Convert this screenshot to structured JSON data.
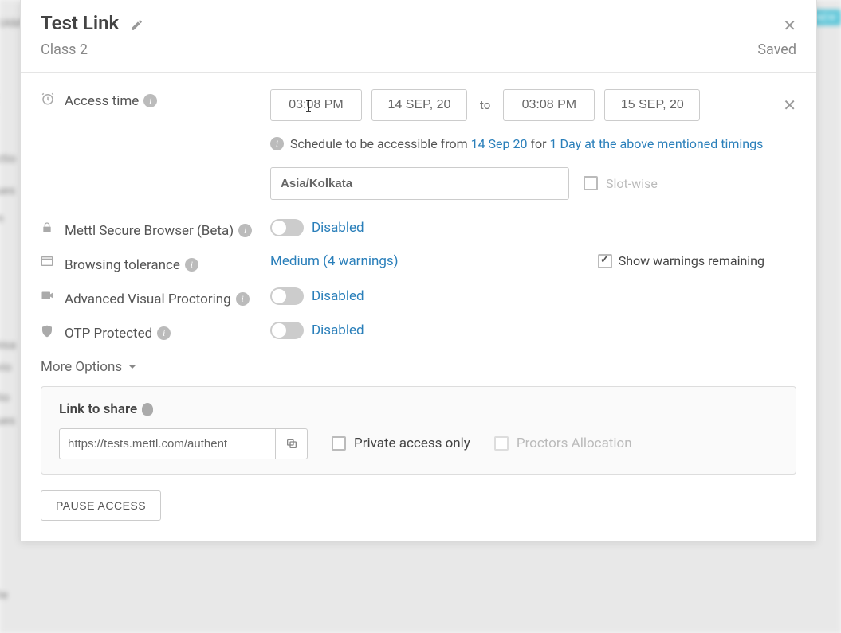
{
  "header": {
    "title": "Test Link",
    "subtitle": "Class 2",
    "saved": "Saved"
  },
  "access_time": {
    "label": "Access time",
    "from_time": "03:08 PM",
    "from_date": "14 SEP, 20",
    "to": "to",
    "to_time": "03:08 PM",
    "to_date": "15 SEP, 20",
    "schedule_prefix": "Schedule to be accessible from ",
    "schedule_date": "14 Sep 20",
    "schedule_for": " for ",
    "schedule_duration": "1 Day at the above mentioned timings",
    "timezone": "Asia/Kolkata",
    "slotwise_label": "Slot-wise"
  },
  "secure_browser": {
    "label": "Mettl Secure Browser (Beta)",
    "status": "Disabled"
  },
  "browsing_tolerance": {
    "label": "Browsing tolerance",
    "value": "Medium (4 warnings)",
    "show_warnings_label": "Show warnings remaining"
  },
  "proctoring": {
    "label": "Advanced Visual Proctoring",
    "status": "Disabled"
  },
  "otp": {
    "label": "OTP Protected",
    "status": "Disabled"
  },
  "more_options": "More Options",
  "share": {
    "title": "Link to share",
    "url": "https://tests.mettl.com/authent",
    "private_label": "Private access only",
    "proctors_label": "Proctors Allocation"
  },
  "pause_btn": "PAUSE ACCESS",
  "bg": {
    "new": "NEW"
  }
}
